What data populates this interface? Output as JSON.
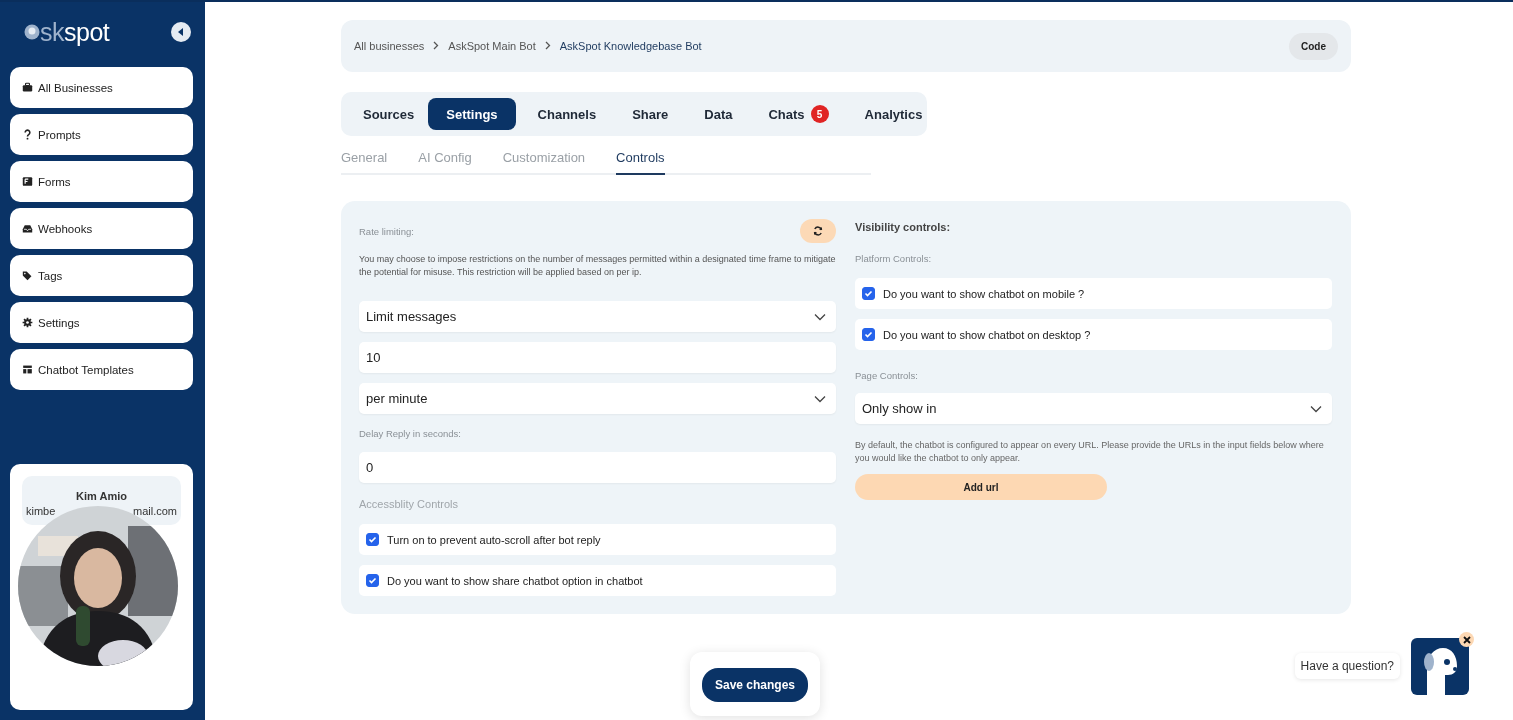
{
  "sidebar": {
    "logo": {
      "ask": "sk",
      "spot": "spot"
    },
    "items": [
      {
        "label": "All Businesses"
      },
      {
        "label": "Prompts"
      },
      {
        "label": "Forms"
      },
      {
        "label": "Webhooks"
      },
      {
        "label": "Tags"
      },
      {
        "label": "Settings"
      },
      {
        "label": "Chatbot Templates"
      }
    ],
    "user": {
      "name": "Kim Amio",
      "email_start": "kimbe",
      "email_end": "mail.com"
    }
  },
  "breadcrumb": [
    "All businesses",
    "AskSpot Main Bot",
    "AskSpot Knowledgebase Bot"
  ],
  "code_button": "Code",
  "tabs": [
    {
      "label": "Sources",
      "selected": false
    },
    {
      "label": "Settings",
      "selected": true
    },
    {
      "label": "Channels",
      "selected": false
    },
    {
      "label": "Share",
      "selected": false
    },
    {
      "label": "Data",
      "selected": false
    },
    {
      "label": "Chats",
      "selected": false,
      "badge": "5"
    },
    {
      "label": "Analytics",
      "selected": false
    }
  ],
  "subtabs": [
    {
      "label": "General",
      "selected": false
    },
    {
      "label": "AI Config",
      "selected": false
    },
    {
      "label": "Customization",
      "selected": false
    },
    {
      "label": "Controls",
      "selected": true
    }
  ],
  "rate_limiting": {
    "title": "Rate limiting:",
    "description": "You may choose to impose restrictions on the number of messages permitted within a designated time frame to mitigate the potential for misuse. This restriction will be applied based on per ip.",
    "limit_type": "Limit messages",
    "count": "10",
    "period": "per minute",
    "delay_label": "Delay Reply in seconds:",
    "delay": "0"
  },
  "accessibility": {
    "title": "Accessblity Controls",
    "options": [
      {
        "label": "Turn on to prevent auto-scroll after bot reply",
        "checked": true
      },
      {
        "label": "Do you want to show share chatbot option in chatbot",
        "checked": true
      }
    ]
  },
  "visibility": {
    "title": "Visibility controls:",
    "platform_title": "Platform Controls:",
    "platform_options": [
      {
        "label": "Do you want to show chatbot on mobile ?",
        "checked": true
      },
      {
        "label": "Do you want to show chatbot on desktop ?",
        "checked": true
      }
    ],
    "page_title": "Page Controls:",
    "page_mode": "Only show in",
    "note": "By default, the chatbot is configured to appear on every URL. Please provide the URLs in the input fields below where you would like the chatbot to only appear.",
    "add_button": "Add url"
  },
  "save_button": "Save changes",
  "chat_widget": {
    "prompt": "Have a question?"
  }
}
